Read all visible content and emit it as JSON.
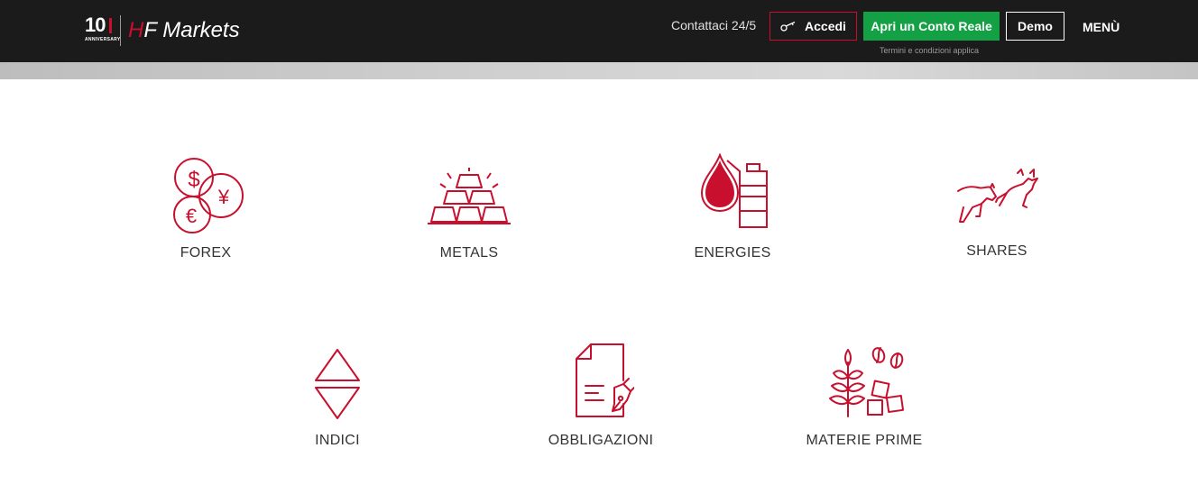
{
  "header": {
    "logo": {
      "number": "10",
      "anniversary": "ANNIVERSARY",
      "brand_prefix": "H",
      "brand_rest": "F Markets"
    },
    "contact_link": "Contattaci 24/5",
    "login_button": "Accedi",
    "real_account_button": "Apri un Conto Reale",
    "demo_button": "Demo",
    "terms_note": "Termini e condizioni applica",
    "menu_button": "MENÙ"
  },
  "colors": {
    "brand_red": "#c8102e",
    "cta_green": "#14a044",
    "header_bg": "#1b1b1b"
  },
  "categories": [
    {
      "label": "FOREX",
      "icon": "coins-icon"
    },
    {
      "label": "METALS",
      "icon": "gold-bars-icon"
    },
    {
      "label": "ENERGIES",
      "icon": "oil-barrel-icon"
    },
    {
      "label": "SHARES",
      "icon": "bull-bear-icon"
    },
    {
      "label": "INDICI",
      "icon": "up-down-triangles-icon"
    },
    {
      "label": "OBBLIGAZIONI",
      "icon": "bond-document-icon"
    },
    {
      "label": "MATERIE PRIME",
      "icon": "commodities-icon"
    }
  ]
}
